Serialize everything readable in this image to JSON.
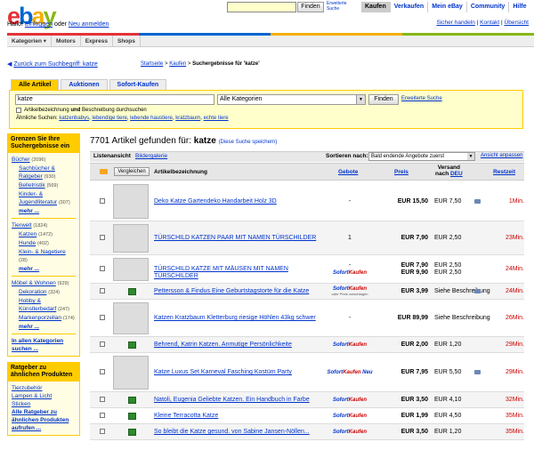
{
  "header": {
    "logo_letters": [
      "e",
      "b",
      "a",
      "y"
    ],
    "greeting_prefix": "Hallo!",
    "login": "Einloggen",
    "or": "oder",
    "register": "Neu anmelden",
    "search_value": "",
    "search_button": "Finden",
    "advanced_search": "Erweiterte Suche",
    "nav": [
      "Kaufen",
      "Verkaufen",
      "Mein eBay",
      "Community",
      "Hilfe"
    ],
    "links": [
      "Sicher handeln",
      "Kontakt",
      "Übersicht"
    ],
    "colors": [
      "#e53238",
      "#0064d2",
      "#f5af02",
      "#86b817"
    ]
  },
  "catnav": [
    "Kategorien ▾",
    "Motors",
    "Express",
    "Shops"
  ],
  "breadcrumb": {
    "back": "Zurück zum Suchbegriff: katze",
    "items": [
      "Startseite",
      "Kaufen"
    ],
    "current": "Suchergebnisse für 'katze'"
  },
  "search": {
    "tabs": [
      "Alle Artikel",
      "Auktionen",
      "Sofort-Kaufen"
    ],
    "query": "katze",
    "category": "Alle Kategorien",
    "find_button": "Finden",
    "advanced": "Erweiterte Suche",
    "checkbox_pre": "Artikelbezeichnung",
    "checkbox_bold": "und",
    "checkbox_post": "Beschreibung durchsuchen",
    "similar_label": "Ähnliche Suchen:",
    "similar": [
      "katzenbabys",
      "lebendige tiere",
      "lebende haustiere",
      "kratzbaum",
      "echte tiere"
    ]
  },
  "sidebar": {
    "narrow_title": "Grenzen Sie Ihre Suchergebnisse ein",
    "groups": [
      {
        "label": "Bücher",
        "count": "(2096)",
        "children": [
          {
            "label": "Sachbücher & Ratgeber",
            "count": "(930)"
          },
          {
            "label": "Belletristik",
            "count": "(569)"
          },
          {
            "label": "Kinder- & Jugendliteratur",
            "count": "(307)"
          }
        ],
        "more": "mehr ..."
      },
      {
        "label": "Tierwelt",
        "count": "(1824)",
        "children": [
          {
            "label": "Katzen",
            "count": "(1472)"
          },
          {
            "label": "Hunde",
            "count": "(402)"
          },
          {
            "label": "Klein- & Nagetiere",
            "count": "(28)"
          }
        ],
        "more": "mehr ..."
      },
      {
        "label": "Möbel & Wohnen",
        "count": "(929)",
        "children": [
          {
            "label": "Dekoration",
            "count": "(324)"
          },
          {
            "label": "Hobby & Künstlerbedarf",
            "count": "(247)"
          },
          {
            "label": "Markenporzellan",
            "count": "(174)"
          }
        ],
        "more": "mehr ..."
      }
    ],
    "all_categories": "In allen Kategorien suchen ...",
    "guides_title": "Ratgeber zu ähnlichen Produkten",
    "guides": [
      "Tierzubehör",
      "Lampen & Licht",
      "Sticken"
    ],
    "guides_all": "Alle Ratgeber zu ähnlichen Produkten aufrufen ..."
  },
  "results": {
    "count_num": "7701",
    "count_mid": "Artikel gefunden für:",
    "count_term": "katze",
    "save_search": "(Diese Suche speichern)",
    "list_view": "Listenansicht",
    "gallery_view": "Bildergalerie",
    "sort_label": "Sortieren nach:",
    "sort_value": "Bald endende Angebote zuerst",
    "customize": "Ansicht anpassen",
    "compare": "Vergleichen",
    "columns": {
      "title": "Artikelbezeichnung",
      "bids": "Gebote",
      "price": "Preis",
      "ship1": "Versand",
      "ship2": "nach",
      "ship_to": "DEU",
      "time": "Restzeit"
    },
    "sofort_a": "Sofort",
    "sofort_b": "Kaufen",
    "sofort_sub": "oder Preis vorschlagen",
    "sofort_neu": "Neu",
    "rows": [
      {
        "title": "Deko Katze Gartendeko Handarbeit Holz 3D",
        "bids": "-",
        "price": "EUR 15,50",
        "price2": "",
        "ship": "EUR 7,50",
        "ship2": "",
        "time": "1Min.",
        "thumb": true,
        "cam": true,
        "sofort": ""
      },
      {
        "title": "TÜRSCHILD KATZEN PAAR MIT NAMEN TÜRSCHILDER",
        "bids": "1",
        "price": "EUR 7,90",
        "price2": "",
        "ship": "EUR 2,50",
        "ship2": "",
        "time": "23Min.",
        "thumb": true,
        "cam": false,
        "sofort": ""
      },
      {
        "title": "TÜRSCHILD KATZE MIT MÄUSEN MIT NAMEN TÜRSCHILDER",
        "bids": "-",
        "price": "EUR 7,90",
        "price2": "EUR 9,90",
        "ship": "EUR 2,50",
        "ship2": "EUR 2,50",
        "time": "24Min.",
        "thumb": true,
        "cam": false,
        "sofort": "plain"
      },
      {
        "title": "Pettersson & Findus Eine Geburtstagstorte für die Katze",
        "bids": "",
        "price": "EUR 3,99",
        "price2": "",
        "ship": "Siehe Beschreibung",
        "ship2": "",
        "time": "24Min.",
        "thumb": false,
        "cam": true,
        "sofort": "offer"
      },
      {
        "title": "Katzen Kratzbaum Kletterburg riesige Höhlen 43kg schwer",
        "bids": "-",
        "price": "EUR 89,99",
        "price2": "",
        "ship": "Siehe Beschreibung",
        "ship2": "",
        "time": "26Min.",
        "thumb": true,
        "cam": false,
        "sofort": ""
      },
      {
        "title": "Behrend, Katrin Katzen. Anmutige Persönlichkeite",
        "bids": "",
        "price": "EUR 2,00",
        "price2": "",
        "ship": "EUR 1,20",
        "ship2": "",
        "time": "29Min.",
        "thumb": false,
        "cam": false,
        "sofort": "plain"
      },
      {
        "title": "Katze Luxus Set Karneval Fasching Kostüm Party",
        "bids": "",
        "price": "EUR 7,95",
        "price2": "",
        "ship": "EUR 5,50",
        "ship2": "",
        "time": "29Min.",
        "thumb": true,
        "cam": true,
        "sofort": "neu"
      },
      {
        "title": "Natoli, Eugenia Geliebte Katzen. Ein Handbuch in Farbe",
        "bids": "",
        "price": "EUR 3,50",
        "price2": "",
        "ship": "EUR 4,10",
        "ship2": "",
        "time": "32Min.",
        "thumb": false,
        "cam": false,
        "sofort": "plain"
      },
      {
        "title": "Kleine Terracotta Katze",
        "bids": "",
        "price": "EUR 1,99",
        "price2": "",
        "ship": "EUR 4,50",
        "ship2": "",
        "time": "35Min.",
        "thumb": false,
        "cam": false,
        "sofort": "plain"
      },
      {
        "title": "So bleibt die Katze gesund. von Sabine Jansen-Nöllen...",
        "bids": "",
        "price": "EUR 3,50",
        "price2": "",
        "ship": "EUR 1,20",
        "ship2": "",
        "time": "35Min.",
        "thumb": false,
        "cam": false,
        "sofort": "plain"
      }
    ]
  }
}
